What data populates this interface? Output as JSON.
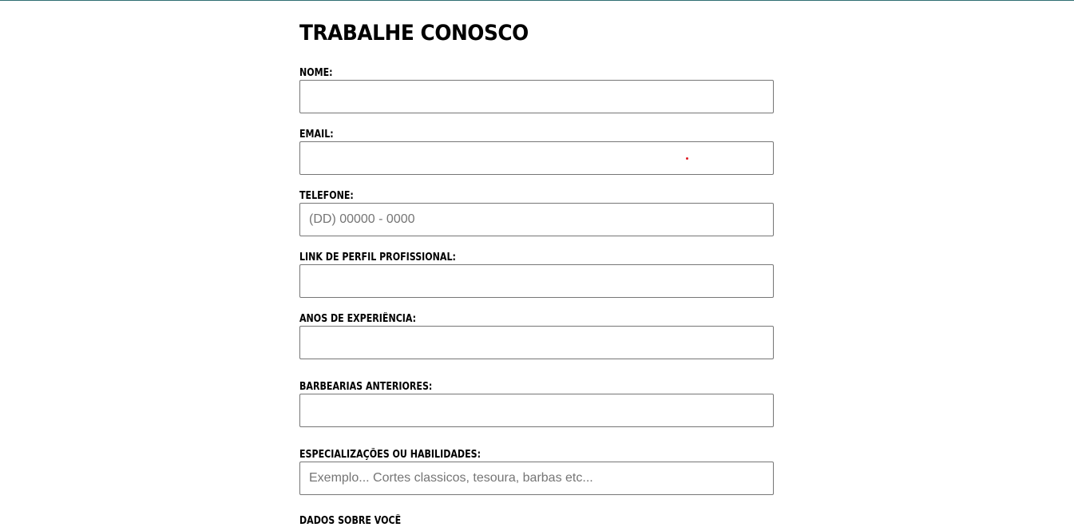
{
  "page": {
    "title": "TRABALHE CONOSCO",
    "accent_line_color": "#2f6f72"
  },
  "form": {
    "fields": [
      {
        "label": "NOME:",
        "value": "",
        "placeholder": ""
      },
      {
        "label": "EMAIL:",
        "value": "",
        "placeholder": ""
      },
      {
        "label": "TELEFONE:",
        "value": "",
        "placeholder": "(DD) 00000 - 0000"
      },
      {
        "label": "LINK DE PERFIL PROFISSIONAL:",
        "value": "",
        "placeholder": ""
      },
      {
        "label": "ANOS DE EXPERIÊNCIA:",
        "value": "",
        "placeholder": ""
      },
      {
        "label": "BARBEARIAS ANTERIORES:",
        "value": "",
        "placeholder": ""
      },
      {
        "label": "ESPECIALIZAÇÕES OU HABILIDADES:",
        "value": "",
        "placeholder": "Exemplo... Cortes classicos, tesoura, barbas etc..."
      }
    ],
    "next_label_partial": "DADOS SOBRE VOCÊ"
  }
}
